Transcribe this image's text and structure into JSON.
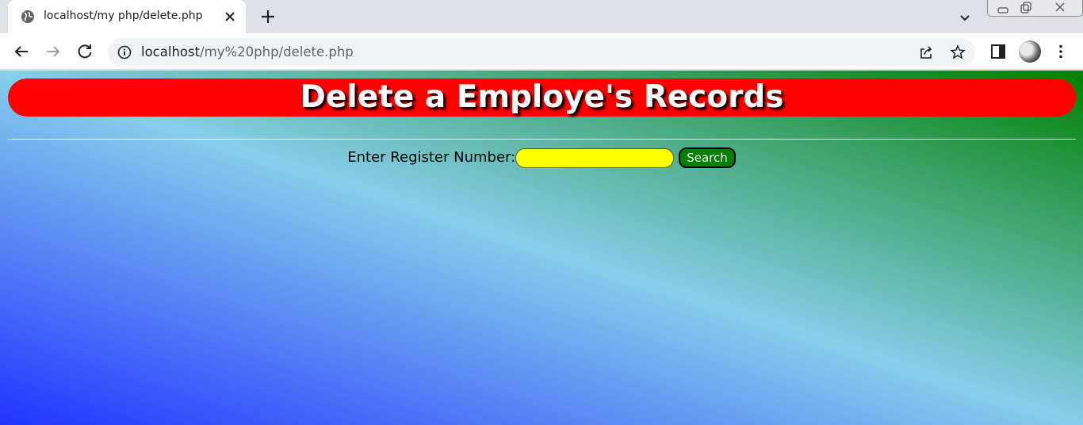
{
  "browser": {
    "tab": {
      "title": "localhost/my php/delete.php"
    },
    "address_bar": {
      "host": "localhost",
      "path": "/my%20php/delete.php"
    },
    "icons": [
      "globe-icon",
      "close-icon",
      "new-tab-icon",
      "tab-search-icon",
      "back-icon",
      "forward-icon",
      "reload-icon",
      "info-icon",
      "share-icon",
      "star-icon",
      "side-panel-icon",
      "avatar",
      "menu-icon"
    ]
  },
  "page": {
    "heading": "Delete a Employe's Records",
    "form": {
      "label": "Enter Register Number:",
      "input_value": "",
      "button_label": "Search"
    },
    "colors": {
      "banner": "#ff0000",
      "input": "#ffff00",
      "button": "#008000",
      "gradient_start": "#2233ff",
      "gradient_mid": "#87ceeb",
      "gradient_end": "#008000"
    }
  }
}
